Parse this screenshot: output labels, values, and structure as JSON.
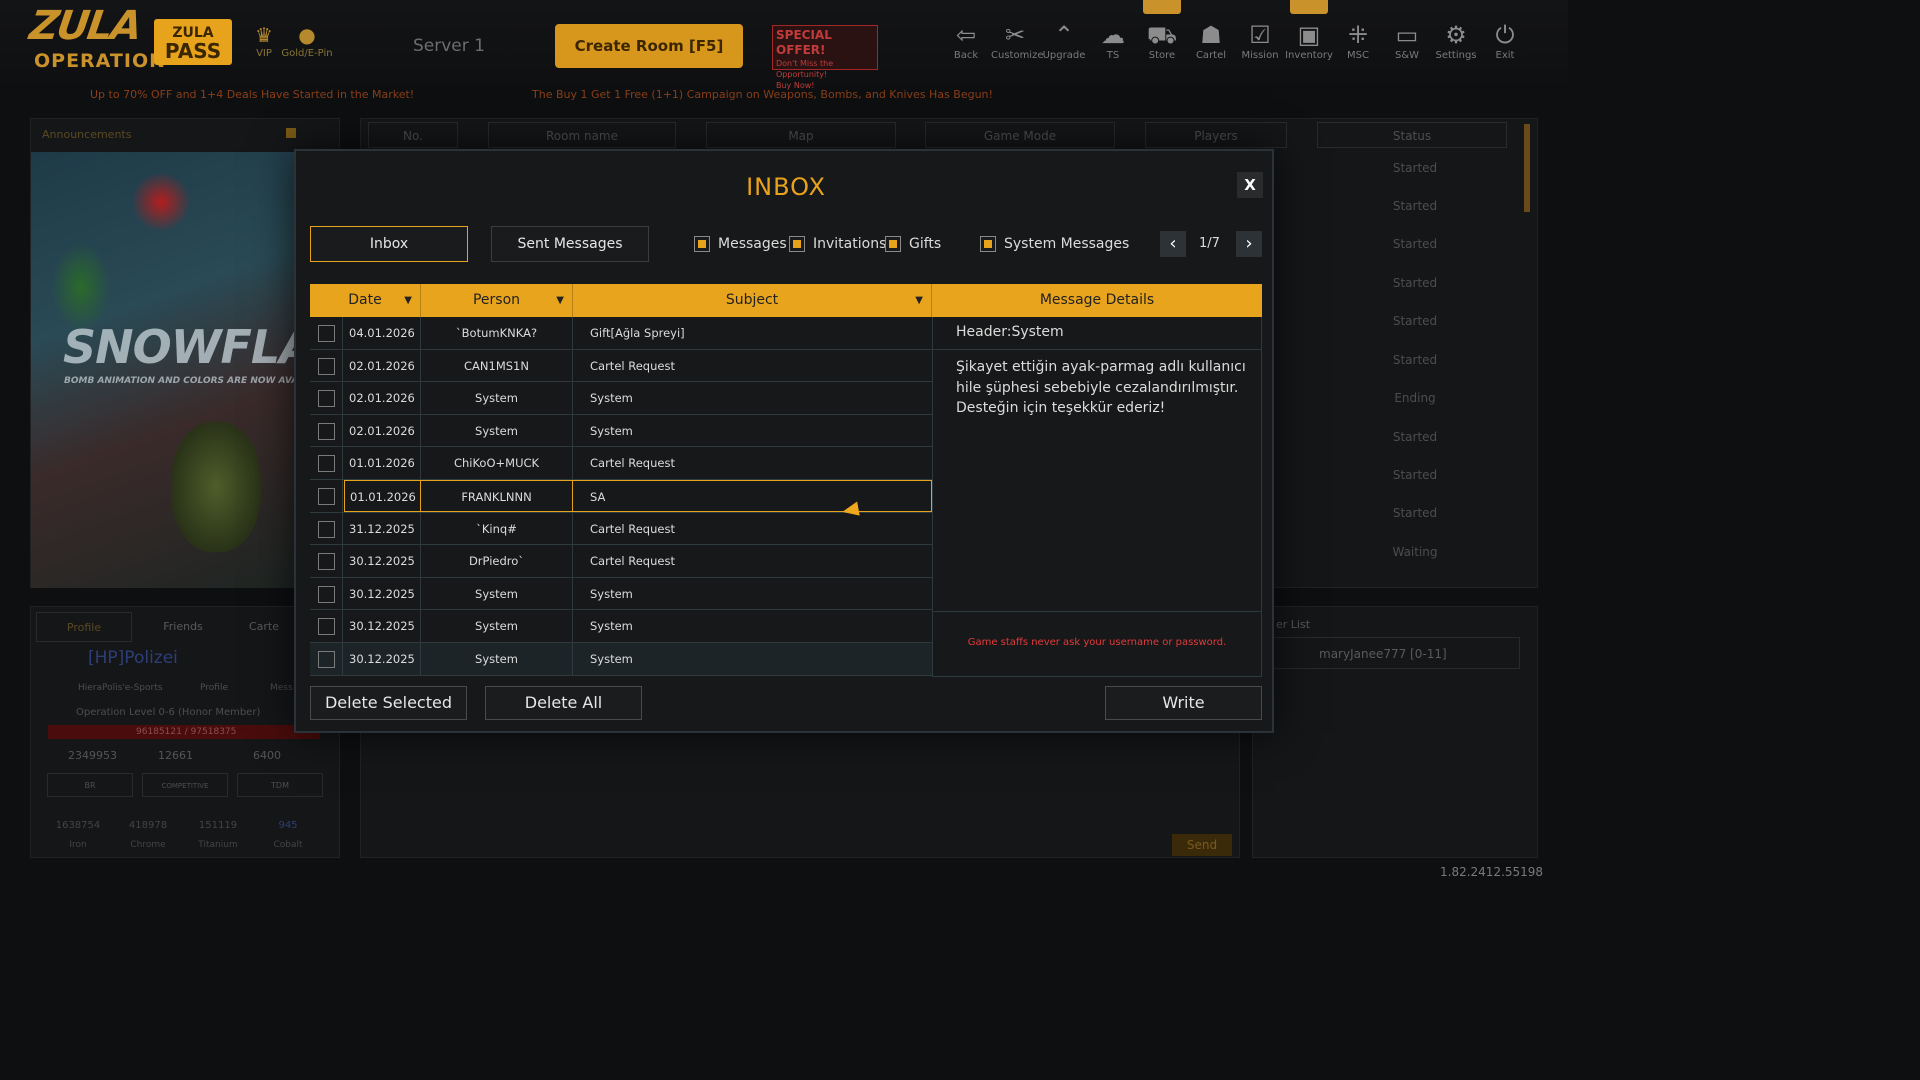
{
  "top": {
    "logo_line1": "ZULA",
    "logo_line2": "OPERATION",
    "zula_pass_top": "ZULA",
    "zula_pass_bottom": "PASS",
    "vip_label": "VIP",
    "gold_label": "Gold/E-Pin",
    "server": "Server 1",
    "create_room": "Create Room [F5]",
    "special_title": "SPECIAL OFFER!",
    "special_sub": "Don't Miss the Opportunity!",
    "special_buy": "Buy Now!",
    "nav": [
      {
        "label": "Back",
        "icon": "back-icon"
      },
      {
        "label": "Customize",
        "icon": "customize-icon"
      },
      {
        "label": "Upgrade",
        "icon": "upgrade-icon"
      },
      {
        "label": "TS",
        "icon": "ts-icon"
      },
      {
        "label": "Store",
        "icon": "store-icon"
      },
      {
        "label": "Cartel",
        "icon": "cartel-icon"
      },
      {
        "label": "Mission",
        "icon": "mission-icon"
      },
      {
        "label": "Inventory",
        "icon": "inventory-icon"
      },
      {
        "label": "MSC",
        "icon": "msc-icon"
      },
      {
        "label": "S&W",
        "icon": "sw-icon"
      },
      {
        "label": "Settings",
        "icon": "gear-icon"
      },
      {
        "label": "Exit",
        "icon": "power-icon"
      }
    ],
    "ticker_left": "Up to 70% OFF and 1+4 Deals Have Started in the Market!",
    "ticker_right": "The Buy 1 Get 1 Free (1+1) Campaign on Weapons, Bombs, and Knives Has Begun!"
  },
  "left": {
    "announcements": "Announcements",
    "banner_title": "SNOWFLAK",
    "banner_sub": "BOMB ANIMATION AND COLORS ARE NOW AVAILABLE I",
    "tabs": [
      "Profile",
      "Friends",
      "Carte"
    ],
    "player_name": "[HP]Polizei",
    "clan": "HieraPolis'e-Sports",
    "profile_btn": "Profile",
    "mess_btn": "Mess",
    "level_text": "Operation Level 0-6 (Honor Member)",
    "xp": "96185121 / 97518375",
    "currency1": "2349953",
    "currency2": "12661",
    "currency3": "6400",
    "modes": [
      "BR",
      "COMPETITIVE",
      "TDM"
    ],
    "ranks": [
      {
        "value": "1638754",
        "label": "Iron"
      },
      {
        "value": "418978",
        "label": "Chrome"
      },
      {
        "value": "151119",
        "label": "Titanium"
      },
      {
        "value": "945",
        "label": "Cobalt"
      }
    ]
  },
  "room_list": {
    "headers": [
      "No.",
      "Room name",
      "Map",
      "Game Mode",
      "Players",
      "Status"
    ],
    "statuses": [
      "Started",
      "Started",
      "Started",
      "Started",
      "Started",
      "Started",
      "Ending",
      "Started",
      "Started",
      "Started",
      "Waiting"
    ]
  },
  "chat": {
    "send": "Send"
  },
  "friends": {
    "title": "er List",
    "entry": "maryJanee777 [0-11]"
  },
  "version": "1.82.2412.55198",
  "modal": {
    "title": "INBOX",
    "close": "X",
    "tab_inbox": "Inbox",
    "tab_sent": "Sent Messages",
    "filters": [
      {
        "label": "Messages",
        "checked": true
      },
      {
        "label": "Invitations",
        "checked": true
      },
      {
        "label": "Gifts",
        "checked": true
      },
      {
        "label": "System Messages",
        "checked": true
      }
    ],
    "page": "1/7",
    "columns": {
      "date": "Date",
      "person": "Person",
      "subject": "Subject",
      "details": "Message Details"
    },
    "rows": [
      {
        "date": "04.01.2026",
        "person": "`BotumKNKA?",
        "subject": "Gift[Ağla Spreyi]"
      },
      {
        "date": "02.01.2026",
        "person": "CAN1MS1N",
        "subject": "Cartel Request"
      },
      {
        "date": "02.01.2026",
        "person": "System",
        "subject": "System"
      },
      {
        "date": "02.01.2026",
        "person": "System",
        "subject": "System"
      },
      {
        "date": "01.01.2026",
        "person": "ChiKoO+MUCK",
        "subject": "Cartel Request"
      },
      {
        "date": "01.01.2026",
        "person": "FRANKLNNN",
        "subject": "SA"
      },
      {
        "date": "31.12.2025",
        "person": "`Kinq#",
        "subject": "Cartel Request"
      },
      {
        "date": "30.12.2025",
        "person": "DrPiedro`",
        "subject": "Cartel Request"
      },
      {
        "date": "30.12.2025",
        "person": "System",
        "subject": "System"
      },
      {
        "date": "30.12.2025",
        "person": "System",
        "subject": "System"
      },
      {
        "date": "30.12.2025",
        "person": "System",
        "subject": "System"
      }
    ],
    "detail_header": "Header:System",
    "detail_body": "Şikayet ettiğin ayak-parmag adlı kullanıcı hile şüphesi sebebiyle cezalandırılmıştır. Desteğin için teşekkür ederiz!",
    "warning": "Game staffs never ask your username or password.",
    "delete_selected": "Delete Selected",
    "delete_all": "Delete All",
    "write": "Write"
  }
}
